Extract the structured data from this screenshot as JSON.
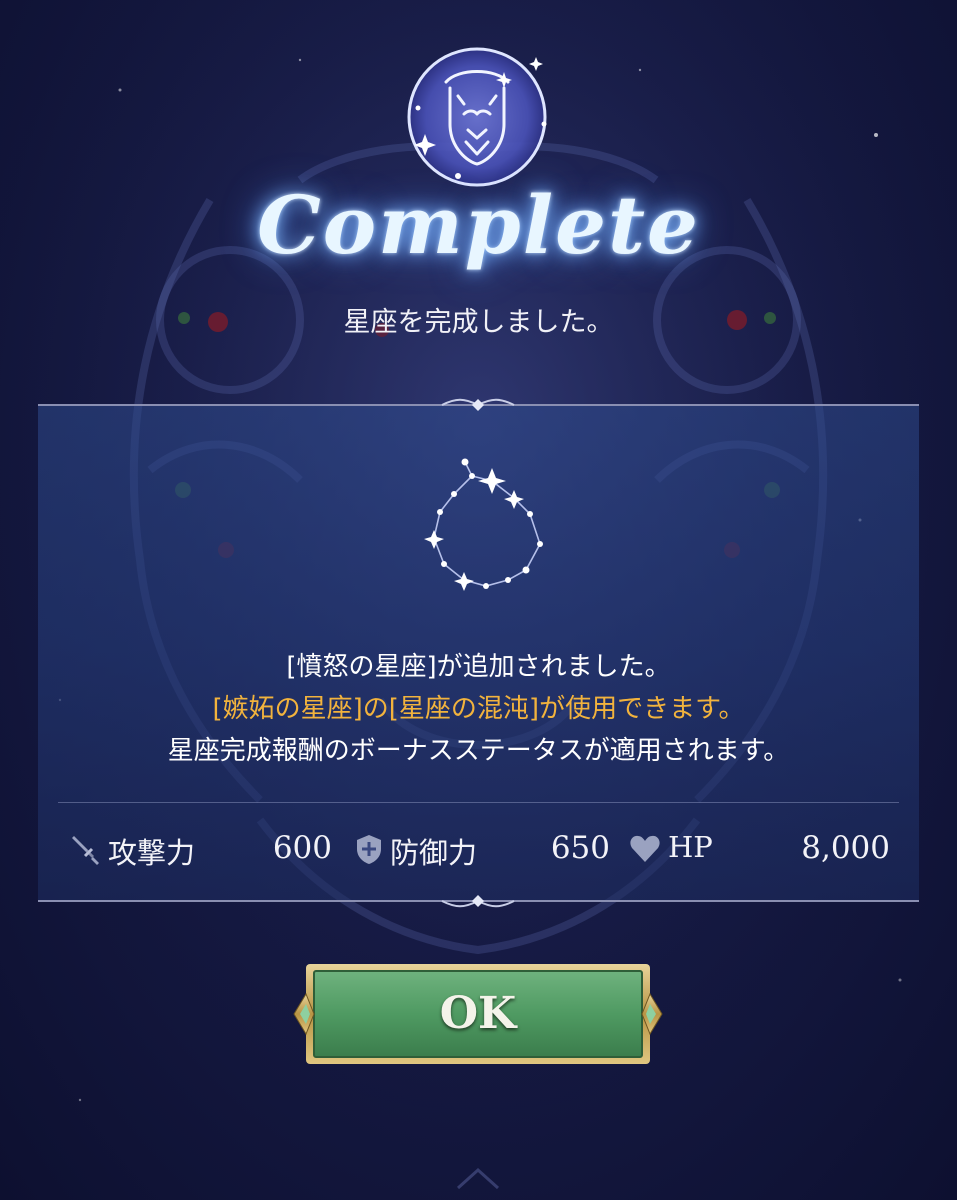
{
  "title": "Complete",
  "subtitle": "星座を完成しました。",
  "messages": {
    "line1": "[憤怒の星座]が追加されました。",
    "line2": "[嫉妬の星座]の[星座の混沌]が使用できます。",
    "line3": "星座完成報酬のボーナスステータスが適用されます。"
  },
  "stats": [
    {
      "icon": "sword-icon",
      "label": "攻撃力",
      "value": "600"
    },
    {
      "icon": "shield-icon",
      "label": "防御力",
      "value": "650"
    },
    {
      "icon": "heart-icon",
      "label": "HP",
      "value": "8,000"
    }
  ],
  "ok_button": {
    "label": "OK"
  },
  "colors": {
    "background": "#161a44",
    "panel": "#2e4a8c",
    "highlight_text": "#f2b33d",
    "button_green": "#4f9a62",
    "button_gold_frame": "#c9a95c",
    "title_glow": "#7fb8ff"
  }
}
